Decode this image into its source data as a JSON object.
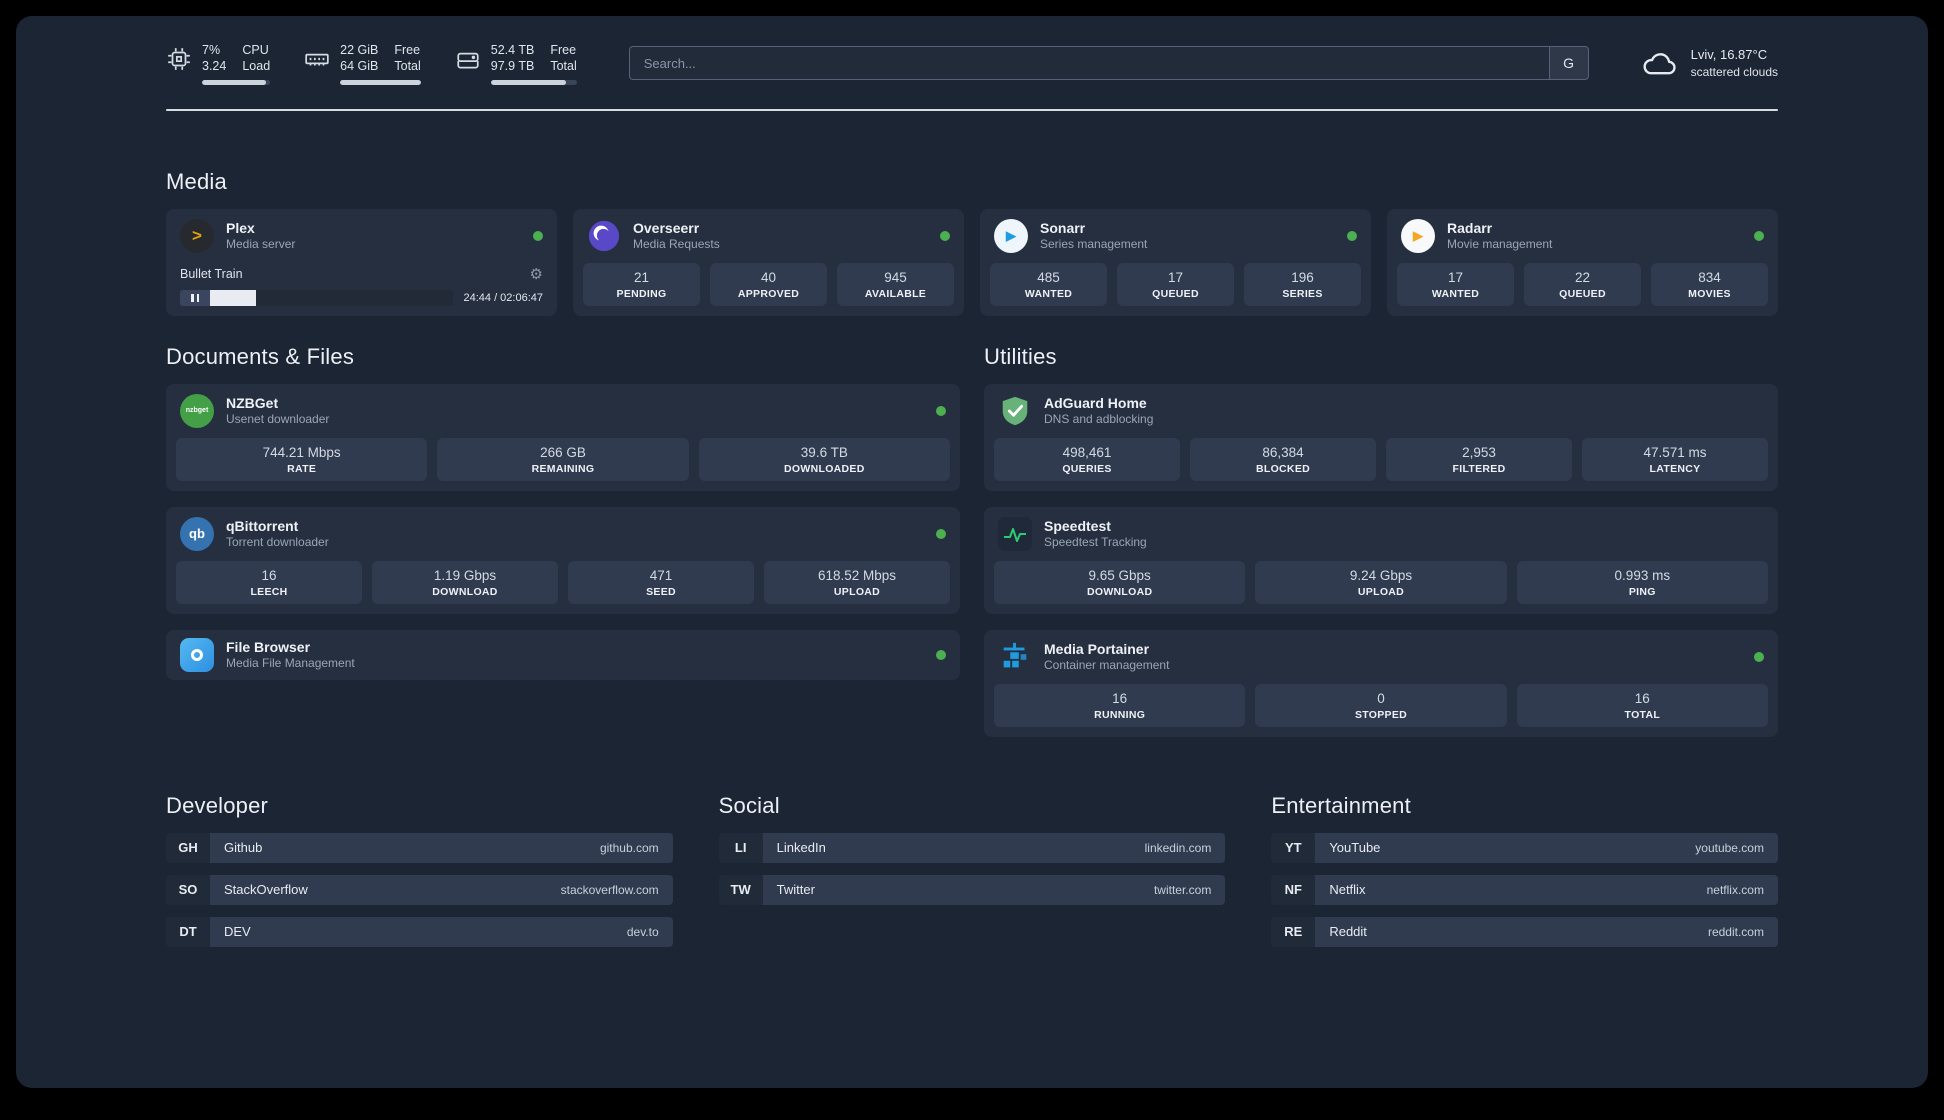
{
  "colors": {
    "status_ok": "#4caf50",
    "plex_amber": "#e5a00d",
    "adguard_green": "#67b279",
    "speedtest_green": "#2ecc71",
    "portainer_blue": "#1e9cdf"
  },
  "header": {
    "cpu": {
      "percent": "7%",
      "load": "3.24",
      "label_top": "CPU",
      "label_bottom": "Load"
    },
    "ram": {
      "free": "22 GiB",
      "total": "64 GiB",
      "label_top": "Free",
      "label_bottom": "Total"
    },
    "disk": {
      "free": "52.4 TB",
      "total": "97.9 TB",
      "label_top": "Free",
      "label_bottom": "Total"
    },
    "search": {
      "placeholder": "Search...",
      "button_label": "G"
    },
    "weather": {
      "location": "Lviv, 16.87°C",
      "condition": "scattered clouds"
    }
  },
  "sections": {
    "media": "Media",
    "documents": "Documents & Files",
    "utilities": "Utilities",
    "developer": "Developer",
    "social": "Social",
    "entertainment": "Entertainment"
  },
  "apps": {
    "plex": {
      "name": "Plex",
      "subtitle": "Media server",
      "now_playing": "Bullet Train",
      "time": "24:44 / 02:06:47"
    },
    "overseerr": {
      "name": "Overseerr",
      "subtitle": "Media Requests",
      "stats": [
        {
          "value": "21",
          "label": "PENDING"
        },
        {
          "value": "40",
          "label": "APPROVED"
        },
        {
          "value": "945",
          "label": "AVAILABLE"
        }
      ]
    },
    "sonarr": {
      "name": "Sonarr",
      "subtitle": "Series management",
      "stats": [
        {
          "value": "485",
          "label": "WANTED"
        },
        {
          "value": "17",
          "label": "QUEUED"
        },
        {
          "value": "196",
          "label": "SERIES"
        }
      ]
    },
    "radarr": {
      "name": "Radarr",
      "subtitle": "Movie management",
      "stats": [
        {
          "value": "17",
          "label": "WANTED"
        },
        {
          "value": "22",
          "label": "QUEUED"
        },
        {
          "value": "834",
          "label": "MOVIES"
        }
      ]
    },
    "nzbget": {
      "name": "NZBGet",
      "subtitle": "Usenet downloader",
      "icon_text": "nzbget",
      "stats": [
        {
          "value": "744.21 Mbps",
          "label": "RATE"
        },
        {
          "value": "266 GB",
          "label": "REMAINING"
        },
        {
          "value": "39.6 TB",
          "label": "DOWNLOADED"
        }
      ]
    },
    "qbittorrent": {
      "name": "qBittorrent",
      "subtitle": "Torrent downloader",
      "icon_text": "qb",
      "stats": [
        {
          "value": "16",
          "label": "LEECH"
        },
        {
          "value": "1.19 Gbps",
          "label": "DOWNLOAD"
        },
        {
          "value": "471",
          "label": "SEED"
        },
        {
          "value": "618.52 Mbps",
          "label": "UPLOAD"
        }
      ]
    },
    "filebrowser": {
      "name": "File Browser",
      "subtitle": "Media File Management"
    },
    "adguard": {
      "name": "AdGuard Home",
      "subtitle": "DNS and adblocking",
      "stats": [
        {
          "value": "498,461",
          "label": "QUERIES"
        },
        {
          "value": "86,384",
          "label": "BLOCKED"
        },
        {
          "value": "2,953",
          "label": "FILTERED"
        },
        {
          "value": "47.571 ms",
          "label": "LATENCY"
        }
      ]
    },
    "speedtest": {
      "name": "Speedtest",
      "subtitle": "Speedtest Tracking",
      "stats": [
        {
          "value": "9.65 Gbps",
          "label": "DOWNLOAD"
        },
        {
          "value": "9.24 Gbps",
          "label": "UPLOAD"
        },
        {
          "value": "0.993 ms",
          "label": "PING"
        }
      ]
    },
    "portainer": {
      "name": "Media Portainer",
      "subtitle": "Container management",
      "stats": [
        {
          "value": "16",
          "label": "RUNNING"
        },
        {
          "value": "0",
          "label": "STOPPED"
        },
        {
          "value": "16",
          "label": "TOTAL"
        }
      ]
    }
  },
  "bookmarks": {
    "developer": [
      {
        "abbr": "GH",
        "name": "Github",
        "url": "github.com"
      },
      {
        "abbr": "SO",
        "name": "StackOverflow",
        "url": "stackoverflow.com"
      },
      {
        "abbr": "DT",
        "name": "DEV",
        "url": "dev.to"
      }
    ],
    "social": [
      {
        "abbr": "LI",
        "name": "LinkedIn",
        "url": "linkedin.com"
      },
      {
        "abbr": "TW",
        "name": "Twitter",
        "url": "twitter.com"
      }
    ],
    "entertainment": [
      {
        "abbr": "YT",
        "name": "YouTube",
        "url": "youtube.com"
      },
      {
        "abbr": "NF",
        "name": "Netflix",
        "url": "netflix.com"
      },
      {
        "abbr": "RE",
        "name": "Reddit",
        "url": "reddit.com"
      }
    ]
  }
}
